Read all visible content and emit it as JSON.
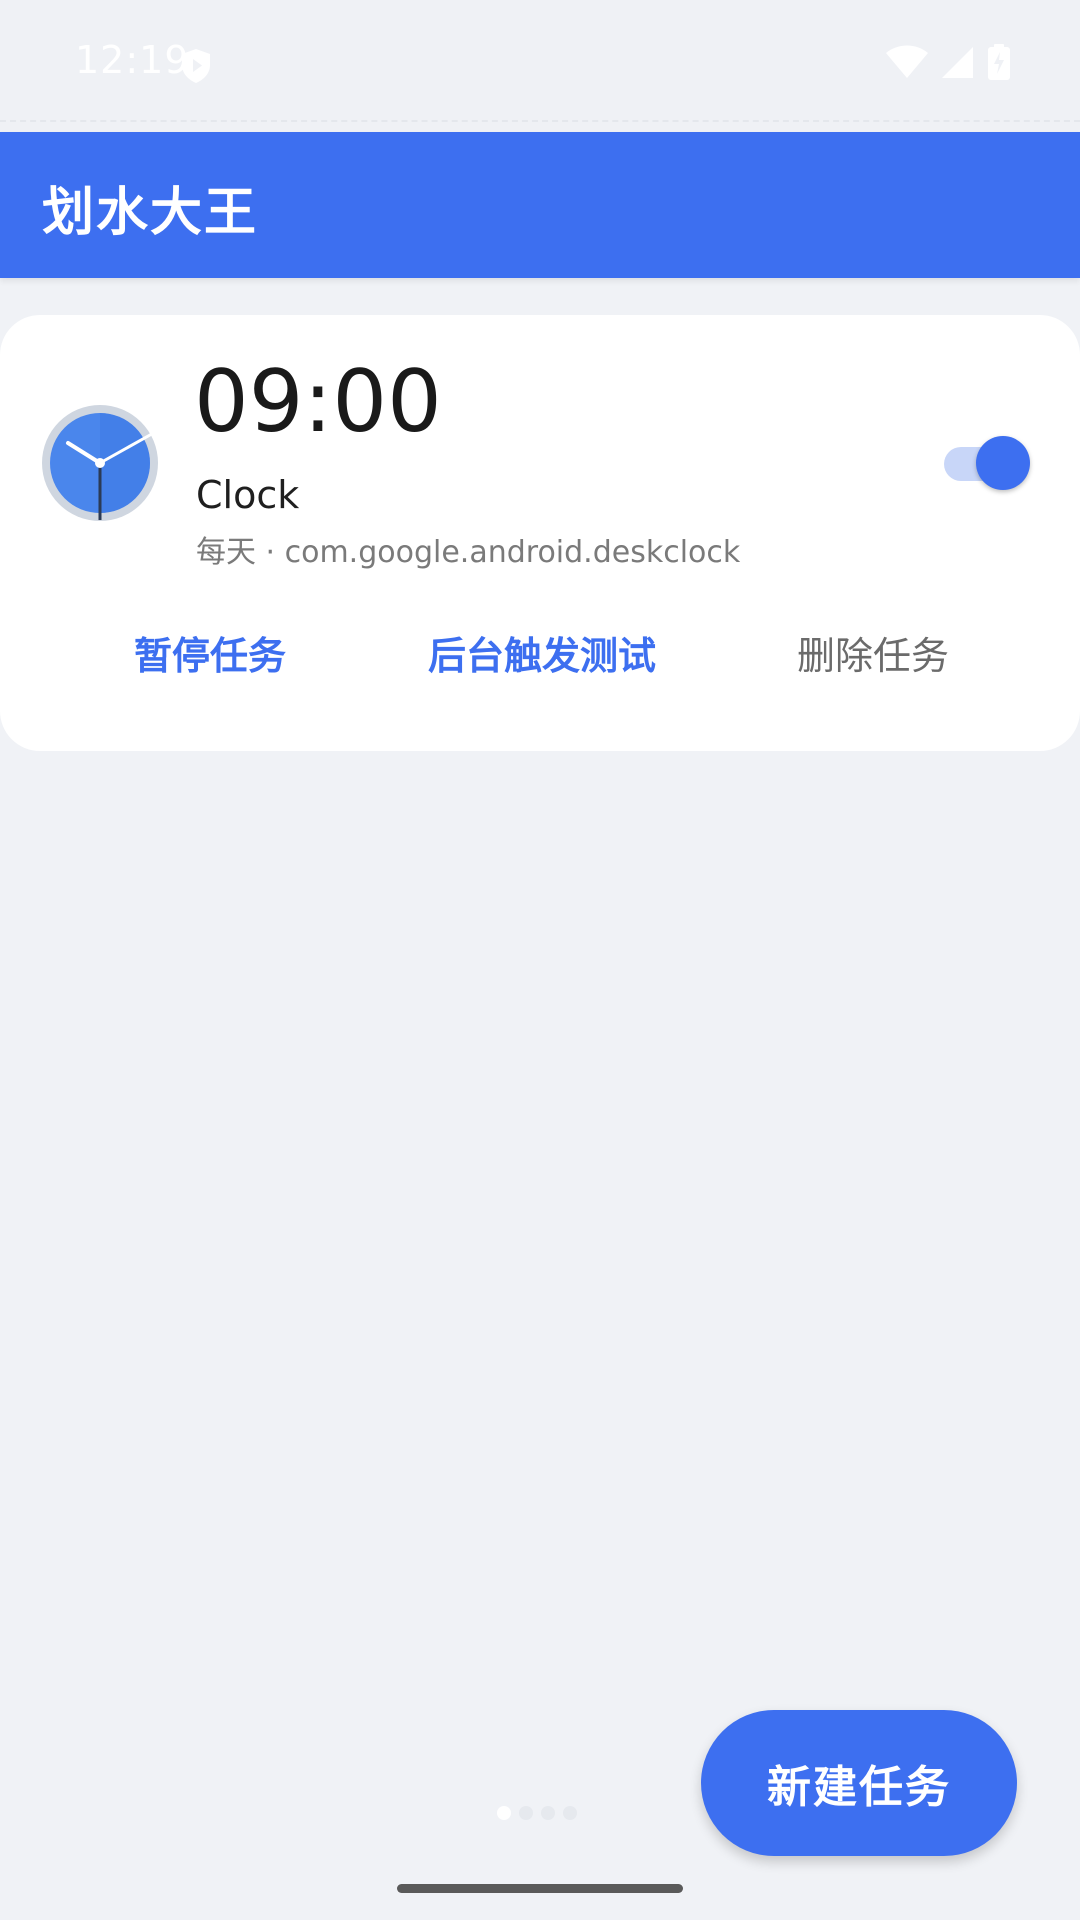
{
  "status_bar": {
    "time": "12:19",
    "icons": [
      "shield-play-icon",
      "wifi-icon",
      "cell-signal-icon",
      "battery-charging-icon"
    ]
  },
  "app_bar": {
    "title": "划水大王",
    "color": "#3d6ff0"
  },
  "task": {
    "time": "09:00",
    "app_name": "Clock",
    "detail": "每天 · com.google.android.deskclock",
    "icon": "clock-app-icon",
    "enabled": true,
    "actions": {
      "pause": "暂停任务",
      "test": "后台触发测试",
      "delete": "删除任务"
    }
  },
  "fab": {
    "label": "新建任务"
  },
  "colors": {
    "accent": "#3d6ff0",
    "background": "#f0f2f6",
    "card": "#ffffff"
  }
}
